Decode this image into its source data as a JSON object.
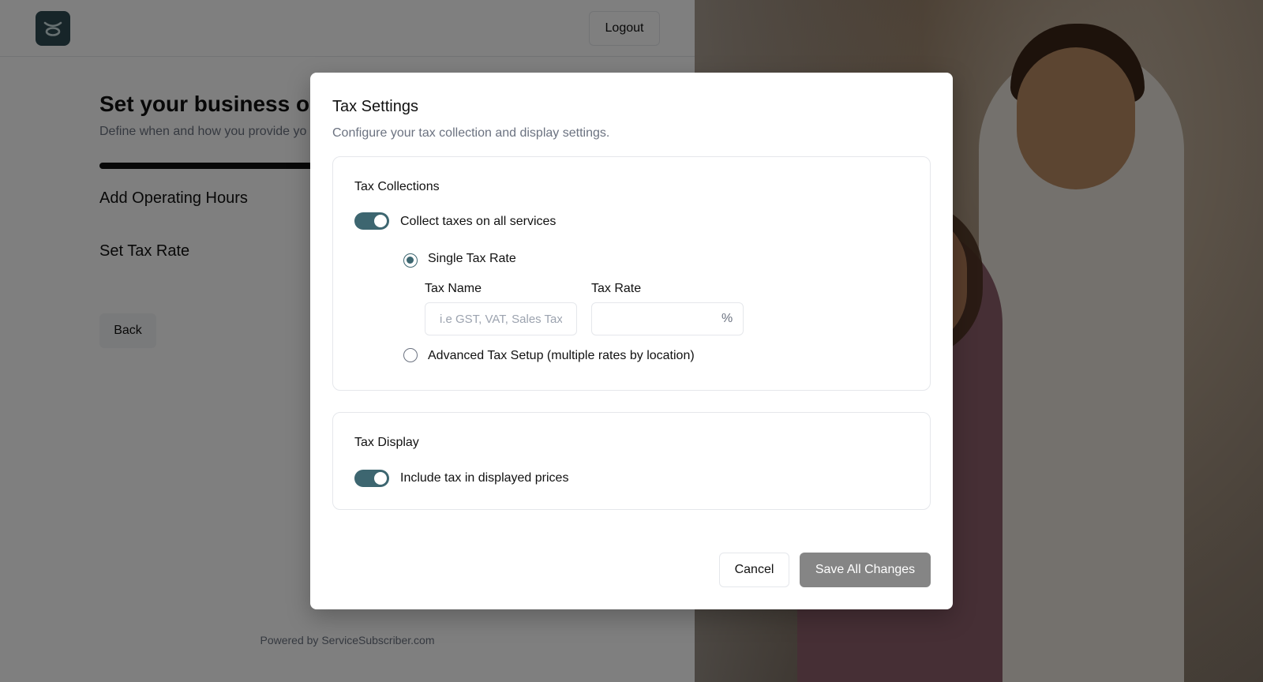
{
  "header": {
    "logo_icon": "brand-logo-icon",
    "logout_label": "Logout"
  },
  "page": {
    "title": "Set your business op",
    "subtitle": "Define when and how you provide yo",
    "steps": [
      "Add Operating Hours",
      "Set Tax Rate"
    ],
    "back_label": "Back",
    "footer": "Powered by ServiceSubscriber.com"
  },
  "modal": {
    "title": "Tax Settings",
    "description": "Configure your tax collection and display settings.",
    "collections": {
      "heading": "Tax Collections",
      "toggle_label": "Collect taxes on all services",
      "toggle_on": true,
      "single_option_label": "Single Tax Rate",
      "single_selected": true,
      "tax_name_label": "Tax Name",
      "tax_name_placeholder": "i.e GST, VAT, Sales Tax",
      "tax_name_value": "",
      "tax_rate_label": "Tax Rate",
      "tax_rate_value": "",
      "tax_rate_suffix": "%",
      "advanced_option_label": "Advanced Tax Setup (multiple rates by location)",
      "advanced_selected": false
    },
    "display": {
      "heading": "Tax Display",
      "toggle_label": "Include tax in displayed prices",
      "toggle_on": true
    },
    "cancel_label": "Cancel",
    "save_label": "Save All Changes"
  },
  "colors": {
    "accent": "#3d6670",
    "overlay": "rgba(0,0,0,0.5)",
    "save_disabled": "#858585"
  }
}
